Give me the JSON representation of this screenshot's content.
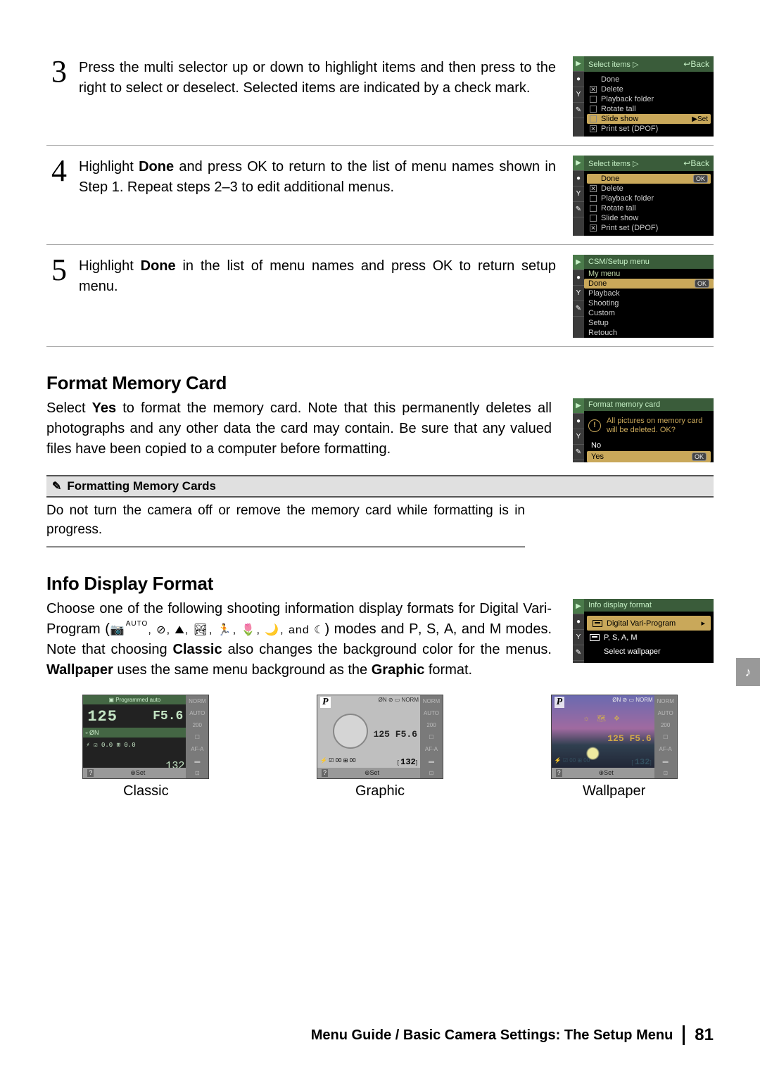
{
  "steps": [
    {
      "num": "3",
      "text_pre": "Press the multi selector up or down to highlight items and then press to the right to select or deselect.  Selected items are indicated by a check mark.",
      "screen": {
        "title": "Select items",
        "back": "Back",
        "items": [
          {
            "label": "Done",
            "checked": null
          },
          {
            "label": "Delete",
            "checked": true
          },
          {
            "label": "Playback folder",
            "checked": false
          },
          {
            "label": "Rotate tall",
            "checked": false
          },
          {
            "label": "Slide show",
            "checked": false,
            "selected": true,
            "right": "▶Set"
          },
          {
            "label": "Print set (DPOF)",
            "checked": true
          }
        ]
      }
    },
    {
      "num": "4",
      "text_parts": [
        "Highlight ",
        "Done",
        " and press ",
        "OK",
        " to return to the list of menu names shown in Step 1.  Repeat steps 2–3 to edit additional menus."
      ],
      "screen": {
        "title": "Select items",
        "back": "Back",
        "items": [
          {
            "label": "Done",
            "checked": null,
            "selected": true,
            "right": "OK"
          },
          {
            "label": "Delete",
            "checked": true
          },
          {
            "label": "Playback folder",
            "checked": false
          },
          {
            "label": "Rotate tall",
            "checked": false
          },
          {
            "label": "Slide show",
            "checked": false
          },
          {
            "label": "Print set (DPOF)",
            "checked": true
          }
        ]
      }
    },
    {
      "num": "5",
      "text_parts": [
        "Highlight ",
        "Done",
        " in the list of menu names and press ",
        "OK",
        " to return setup menu."
      ],
      "screen2": {
        "title": "CSM/Setup menu",
        "sub": "My menu",
        "items": [
          "Done",
          "Playback",
          "Shooting",
          "Custom",
          "Setup",
          "Retouch"
        ],
        "selected": 0
      }
    }
  ],
  "format_card": {
    "heading": "Format Memory Card",
    "body_parts": [
      "Select ",
      "Yes",
      " to format the memory card.  Note that this permanently deletes all photographs and any other data the card may contain.  Be sure that any valued files have been copied to a computer before formatting."
    ],
    "screen": {
      "title": "Format memory card",
      "msg": "All pictures on memory card will be deleted. OK?",
      "no": "No",
      "yes": "Yes",
      "ok": "OK"
    },
    "note_title": "Formatting Memory Cards",
    "note_body": "Do not turn the camera off or remove the memory card while formatting is in progress."
  },
  "info_display": {
    "heading": "Info Display Format",
    "body_parts": [
      "Choose one of the following shooting information display formats for Digital Vari-Program (",
      "AUTO, auto-flash-off, portrait, landscape, child, sports, close-up, and night-portrait",
      ") modes and ",
      "P",
      "S",
      "A",
      "M",
      " modes.  Note that choosing ",
      "Classic",
      " also changes the background color for the menus.   ",
      "Wallpaper",
      " uses the same menu background as the ",
      "Graphic",
      " format."
    ],
    "screen": {
      "title": "Info display format",
      "opt1": "Digital Vari-Program",
      "opt2": "P, S, A, M",
      "opt3": "Select wallpaper"
    },
    "modes": {
      "classic": {
        "label": "Classic",
        "topbar": "Programmed auto",
        "shutter": "125",
        "aperture": "F5.6",
        "mid_left": "ØN",
        "count": "132",
        "bottom": "⚡   ☑ 0.0  ⊞ 0.0",
        "foot": "⊕Set",
        "side": [
          "NORM",
          "AUTO",
          "200",
          "☐",
          "AF-A",
          "▬",
          "⊡"
        ]
      },
      "graphic": {
        "label": "Graphic",
        "p": "P",
        "tops": "ØN  ⊘ ▭ NORM",
        "nums": "125  F5.6",
        "brow": "⚡   ☑ 00 ⊞ 00",
        "cnt": "132",
        "foot": "⊕Set",
        "side": [
          "NORM",
          "AUTO",
          "200",
          "☐",
          "AF-A",
          "▬",
          "⊡"
        ]
      },
      "wallpaper": {
        "label": "Wallpaper",
        "p": "P",
        "tops": "ØN  ⊘ ▭ NORM",
        "iconrow": "☼ 🗺 ❖",
        "nums": "125  F5.6",
        "brow": "⚡ ☑ 00 ⊞ 00",
        "cnt": "132",
        "foot": "⊕Set",
        "side": [
          "NORM",
          "AUTO",
          "200",
          "☐",
          "AF-A",
          "▬",
          "⊡"
        ]
      }
    }
  },
  "footer": {
    "text": "Menu Guide / Basic Camera Settings: The Setup Menu",
    "page": "81"
  },
  "ribbon": "♪"
}
